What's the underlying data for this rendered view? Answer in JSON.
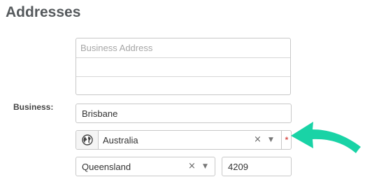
{
  "section": {
    "title": "Addresses"
  },
  "business": {
    "label": "Business:",
    "address_placeholder": "Business Address",
    "address_line1": "",
    "address_line2": "",
    "address_line3": "",
    "city": "Brisbane",
    "country": {
      "icon": "globe-icon",
      "value": "Australia",
      "clear": "×",
      "caret": "▼",
      "required_marker": "*"
    },
    "state": {
      "value": "Queensland",
      "clear": "×",
      "caret": "▼"
    },
    "postcode": "4209"
  },
  "annotation": {
    "icon": "pointer-arrow-icon",
    "color": "#19d3a6"
  },
  "colors": {
    "required": "#d9534f",
    "border": "#c8c8c8"
  }
}
